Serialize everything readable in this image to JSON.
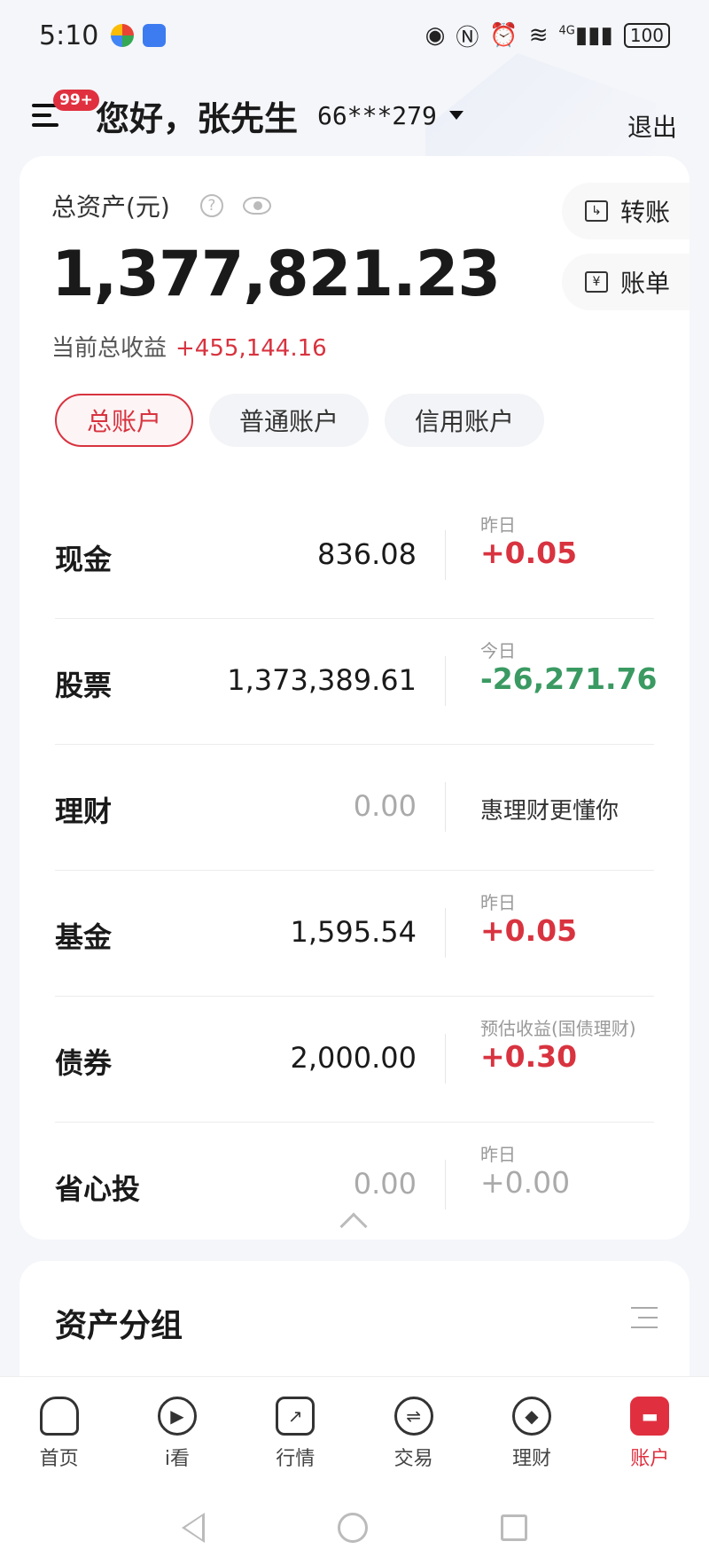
{
  "status_bar": {
    "time": "5:10",
    "network": "4G",
    "battery": "100"
  },
  "header": {
    "badge": "99+",
    "greeting": "您好，张先生",
    "account_number": "66***279",
    "logout": "退出"
  },
  "summary": {
    "total_label": "总资产(元)",
    "total_value": "1,377,821.23",
    "income_label": "当前总收益",
    "income_value": "+455,144.16",
    "transfer": "转账",
    "bill": "账单"
  },
  "tabs": [
    {
      "label": "总账户",
      "active": true
    },
    {
      "label": "普通账户",
      "active": false
    },
    {
      "label": "信用账户",
      "active": false
    }
  ],
  "assets": [
    {
      "name": "现金",
      "amount": "836.08",
      "sub_label": "昨日",
      "delta": "+0.05"
    },
    {
      "name": "股票",
      "amount": "1,373,389.61",
      "sub_label": "今日",
      "delta": "-26,271.76"
    },
    {
      "name": "理财",
      "amount": "0.00",
      "promo": "惠理财更懂你"
    },
    {
      "name": "基金",
      "amount": "1,595.54",
      "sub_label": "昨日",
      "delta": "+0.05"
    },
    {
      "name": "债券",
      "amount": "2,000.00",
      "sub_label": "预估收益(国债理财)",
      "delta": "+0.30"
    },
    {
      "name": "省心投",
      "amount": "0.00",
      "sub_label": "昨日",
      "delta": "+0.00"
    }
  ],
  "group": {
    "title": "资产分组"
  },
  "bottom_nav": [
    {
      "label": "首页",
      "icon": "home-icon"
    },
    {
      "label": "i看",
      "icon": "play-icon"
    },
    {
      "label": "行情",
      "icon": "chart-icon"
    },
    {
      "label": "交易",
      "icon": "exchange-icon"
    },
    {
      "label": "理财",
      "icon": "diamond-icon"
    },
    {
      "label": "账户",
      "icon": "account-icon",
      "active": true
    }
  ],
  "colors": {
    "accent": "#e0303f",
    "up": "#d8333f",
    "down": "#3a9a62"
  }
}
